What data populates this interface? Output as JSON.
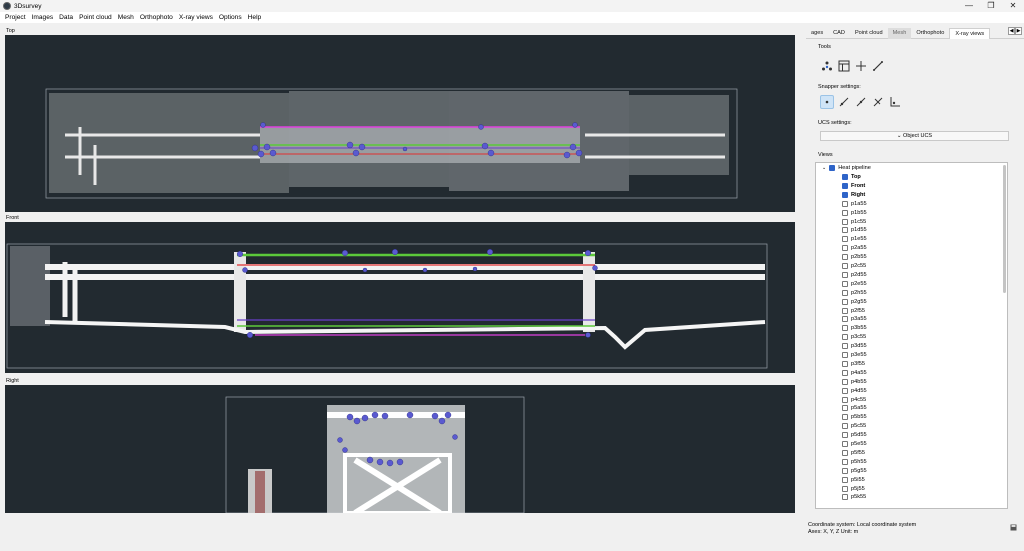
{
  "window": {
    "title": "3Dsurvey",
    "controls": [
      "—",
      "❐",
      "✕"
    ]
  },
  "menu": [
    "Project",
    "Images",
    "Data",
    "Point cloud",
    "Mesh",
    "Orthophoto",
    "X-ray views",
    "Options",
    "Help"
  ],
  "viewports": {
    "top": "Top",
    "front": "Front",
    "right": "Right"
  },
  "tabs": [
    {
      "label": "ages",
      "state": "normal"
    },
    {
      "label": "CAD",
      "state": "normal"
    },
    {
      "label": "Point cloud",
      "state": "normal"
    },
    {
      "label": "Mesh",
      "state": "grey"
    },
    {
      "label": "Orthophoto",
      "state": "normal"
    },
    {
      "label": "X-ray views",
      "state": "active"
    }
  ],
  "tab_arrows": {
    "left": "◀",
    "right": "▶"
  },
  "tools": {
    "title": "Tools",
    "icons": [
      "pointcloud-tool-icon",
      "table-icon",
      "crosshair-icon",
      "measure-line-icon"
    ]
  },
  "snapper": {
    "title": "Snapper settings:",
    "icons": [
      "snap-point-icon",
      "snap-line-icon",
      "snap-midpoint-icon",
      "snap-perpendicular-icon",
      "snap-corner-icon"
    ]
  },
  "ucs": {
    "title": "UCS settings:",
    "button": "⌄ Object UCS"
  },
  "views": {
    "title": "Views",
    "root": "Heat pipeline",
    "children": [
      "Top",
      "Front",
      "Right"
    ],
    "items": [
      "p1a55",
      "p1b55",
      "p1c55",
      "p1d55",
      "p1e55",
      "p2a55",
      "p2b55",
      "p2c55",
      "p2d55",
      "p2e55",
      "p2h55",
      "p2g55",
      "p2f55",
      "p3a55",
      "p3b55",
      "p3c55",
      "p3d55",
      "p3e55",
      "p3f55",
      "p4a55",
      "p4b55",
      "p4d55",
      "p4c55",
      "p5a55",
      "p5b55",
      "p5c55",
      "p5d55",
      "p5e55",
      "p5f55",
      "p5h55",
      "p5g55",
      "p5i55",
      "p5j55",
      "p5k55"
    ]
  },
  "status": {
    "line1": "Coordinate system: Local coordinate system",
    "line2": "Axes: X, Y, Z Unit: m"
  },
  "colors": {
    "viewport_bg": "#222a30",
    "accent": "#2e64c8",
    "green": "#5cc93a",
    "red": "#e03030",
    "magenta": "#e040e0",
    "purple": "#6a3fc9",
    "marker": "#5a5ad0"
  }
}
